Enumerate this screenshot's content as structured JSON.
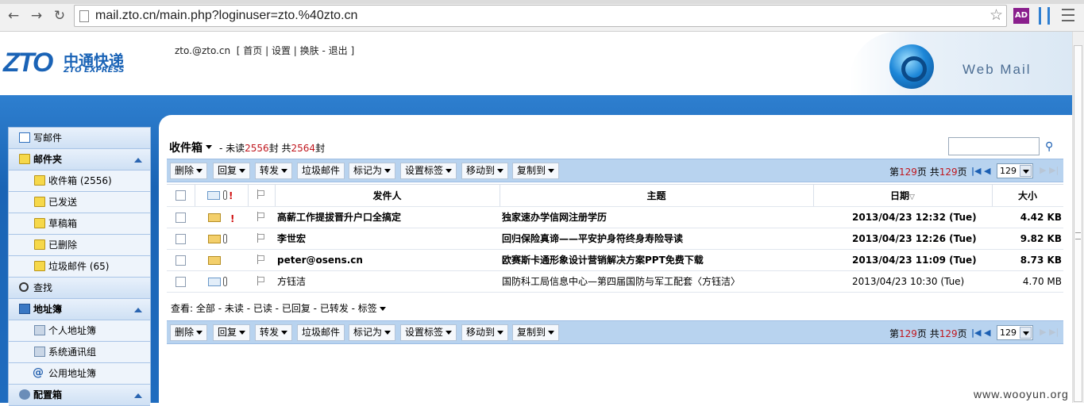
{
  "browser": {
    "url": "mail.zto.cn/main.php?loginuser=zto.%40zto.cn",
    "ext_ad_label": "AD"
  },
  "header": {
    "logo_zto": "ZTO",
    "logo_cn": "中通快递",
    "logo_en": "ZTO EXPRESS",
    "user": "zto.@zto.cn",
    "links": [
      "首页",
      "设置",
      "换肤",
      "退出"
    ],
    "webmail": "Web Mail"
  },
  "sidebar": {
    "compose": "写邮件",
    "folders_title": "邮件夹",
    "inbox": "收件箱 (2556)",
    "sent": "已发送",
    "drafts": "草稿箱",
    "deleted": "已删除",
    "spam": "垃圾邮件 (65)",
    "search": "查找",
    "addressbook_title": "地址簿",
    "personal_ab": "个人地址簿",
    "system_groups": "系统通讯组",
    "public_ab": "公用地址簿",
    "config_title": "配置箱"
  },
  "main": {
    "folder_title": "收件箱",
    "unread_label": "- 未读",
    "unread_count": "2556",
    "unit1": "封 共",
    "total_count": "2564",
    "unit2": "封"
  },
  "toolbar": {
    "delete": "删除",
    "reply": "回复",
    "forward": "转发",
    "junk": "垃圾邮件",
    "markas": "标记为",
    "settag": "设置标签",
    "moveto": "移动到",
    "copyto": "复制到",
    "page_pre": "第",
    "page_num": "129",
    "page_mid": "页 共",
    "page_total": "129",
    "page_suf": "页",
    "page_select": "129"
  },
  "table": {
    "headers": {
      "sender": "发件人",
      "subject": "主题",
      "date": "日期",
      "size": "大小"
    },
    "rows": [
      {
        "sender": "高薪工作提拔晋升户口全搞定",
        "subject": "独家速办学信网注册学历",
        "date": "2013/04/23 12:32 (Tue)",
        "size": "4.42 KB"
      },
      {
        "sender": "李世宏",
        "subject": "回归保险真谛——平安护身符终身寿险导读",
        "date": "2013/04/23 12:26 (Tue)",
        "size": "9.82 KB"
      },
      {
        "sender": "peter@osens.cn",
        "subject": "欧赛斯卡通形象设计营销解决方案PPT免费下载",
        "date": "2013/04/23 11:09 (Tue)",
        "size": "8.73 KB"
      },
      {
        "sender": "方钰洁",
        "subject": "国防科工局信息中心—第四届国防与军工配套〈方钰洁〉",
        "date": "2013/04/23 10:30 (Tue)",
        "size": "4.70 MB"
      }
    ]
  },
  "view": {
    "label": "查看:",
    "all": "全部",
    "unread": "未读",
    "read": "已读",
    "replied": "已回复",
    "forwarded": "已转发",
    "tags": "标签"
  },
  "watermark": "www.wooyun.org",
  "colors": {
    "brand_blue": "#1a63b6",
    "count_red": "#c0171e",
    "toolbar_bg": "#b8d3ef"
  }
}
